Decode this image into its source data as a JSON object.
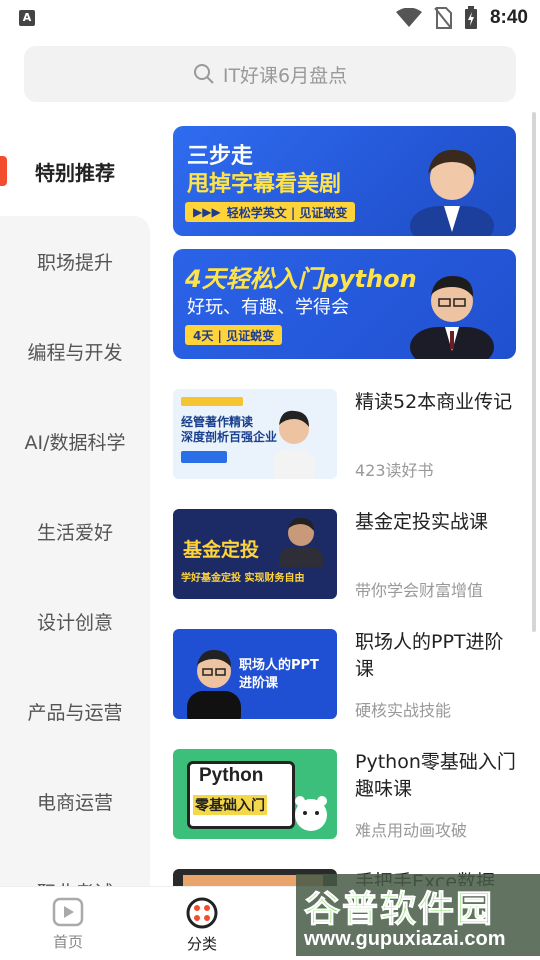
{
  "status_bar": {
    "time": "8:40",
    "left_badge": "A"
  },
  "search": {
    "placeholder": "IT好课6月盘点"
  },
  "sidebar": {
    "items": [
      {
        "label": "特别推荐",
        "active": true
      },
      {
        "label": "职场提升"
      },
      {
        "label": "编程与开发"
      },
      {
        "label": "AI/数据科学"
      },
      {
        "label": "生活爱好"
      },
      {
        "label": "设计创意"
      },
      {
        "label": "产品与运营"
      },
      {
        "label": "电商运营"
      },
      {
        "label": "职业考试"
      }
    ]
  },
  "banners": [
    {
      "line1": "三步走",
      "line2": "甩掉字幕看美剧",
      "tag": "轻松学英文 | 见证蜕变",
      "tag_prefix": "▶▶▶"
    },
    {
      "title": "4天轻松入门python",
      "subtitle": "好玩、有趣、学得会",
      "tag": "4天 | 见证蜕变"
    }
  ],
  "courses": [
    {
      "title": "精读52本商业传记",
      "subtitle": "423读好书",
      "thumb_text": "经管著作精读\n深度剖析百强企业",
      "thumb_bg": "#eaf3fb"
    },
    {
      "title": "基金定投实战课",
      "subtitle": "带你学会财富增值",
      "thumb_text": "基金定投",
      "thumb_sub": "学好基金定投 实现财务自由",
      "thumb_bg": "#1c2a66"
    },
    {
      "title": "职场人的PPT进阶课",
      "subtitle": "硬核实战技能",
      "thumb_text": "职场人的PPT\n进阶课",
      "thumb_bg": "#1f4fd2"
    },
    {
      "title": "Python零基础入门趣味课",
      "subtitle": "难点用动画攻破",
      "thumb_text": "Python\n零基础入门",
      "thumb_bg": "#3bbf7a"
    },
    {
      "title": "手把手Exce数据",
      "subtitle": "",
      "thumb_text": "",
      "thumb_bg": "#2a2a2a"
    }
  ],
  "bottom_nav": [
    {
      "label": "首页",
      "icon": "play-icon"
    },
    {
      "label": "分类",
      "icon": "category-icon",
      "active": true
    }
  ],
  "watermark": {
    "text": "谷普软件园",
    "url": "www.gupuxiazai.com"
  },
  "colors": {
    "accent": "#f24e2e",
    "banner_blue": "#2f6cf0",
    "tag_yellow": "#ffd43a"
  }
}
